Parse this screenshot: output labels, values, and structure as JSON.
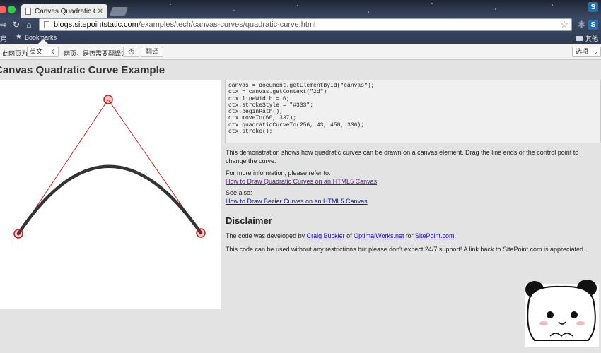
{
  "browser": {
    "tab_title": "Canvas Quadratic Curve E",
    "tab_close": "✕",
    "url_host": "blogs.sitepointstatic.com",
    "url_path": "/examples/tech/canvas-curves/quadratic-curve.html",
    "extension_letter": "S"
  },
  "bookmarks": {
    "apps_label": "应用",
    "bookmarks_label": "Bookmarks",
    "other_label": "其他"
  },
  "translate_bar": {
    "prefix": "此网页为",
    "language": "英文",
    "question": "网页，是否需要翻译?",
    "no_button": "否",
    "translate_button": "翻译",
    "options": "选项"
  },
  "page": {
    "title": "Canvas Quadratic Curve Example",
    "code_lines": [
      "canvas = document.getElementById(\"canvas\");",
      "ctx = canvas.getContext(\"2d\")",
      "ctx.lineWidth = 6;",
      "ctx.strokeStyle = \"#333\";",
      "ctx.beginPath();",
      "ctx.moveTo(60, 337);",
      "ctx.quadraticCurveTo(256, 43, 458, 336);",
      "ctx.stroke();"
    ],
    "description": "This demonstration shows how quadratic curves can be drawn on a canvas element. Drag the line ends or the control point to change the curve.",
    "more_info": "For more information, please refer to:",
    "link_quadratic": "How to Draw Quadratic Curves on an HTML5 Canvas",
    "see_also": "See also:",
    "link_bezier": "How to Draw Bezier Curves on an HTML5 Canvas",
    "disclaimer_title": "Disclaimer",
    "dev_prefix": "The code was developed by ",
    "dev_author": "Craig Buckler",
    "dev_of": " of ",
    "dev_company": "OptimalWorks.net",
    "dev_for": " for ",
    "dev_site": "SitePoint.com",
    "dev_end": ".",
    "usage": "This code can be used without any restrictions but please don't expect 24/7 support! A link back to SitePoint.com is appreciated."
  },
  "colors": {
    "curve": "#333333",
    "control_line": "#cc2222",
    "link": "#1a0dab",
    "visited_link": "#551a8b"
  },
  "icons": {
    "back": "back-arrow-icon",
    "forward": "forward-arrow-icon",
    "reload": "reload-icon",
    "home": "home-icon",
    "star": "bookmark-star-icon",
    "settings": "gear-icon"
  }
}
